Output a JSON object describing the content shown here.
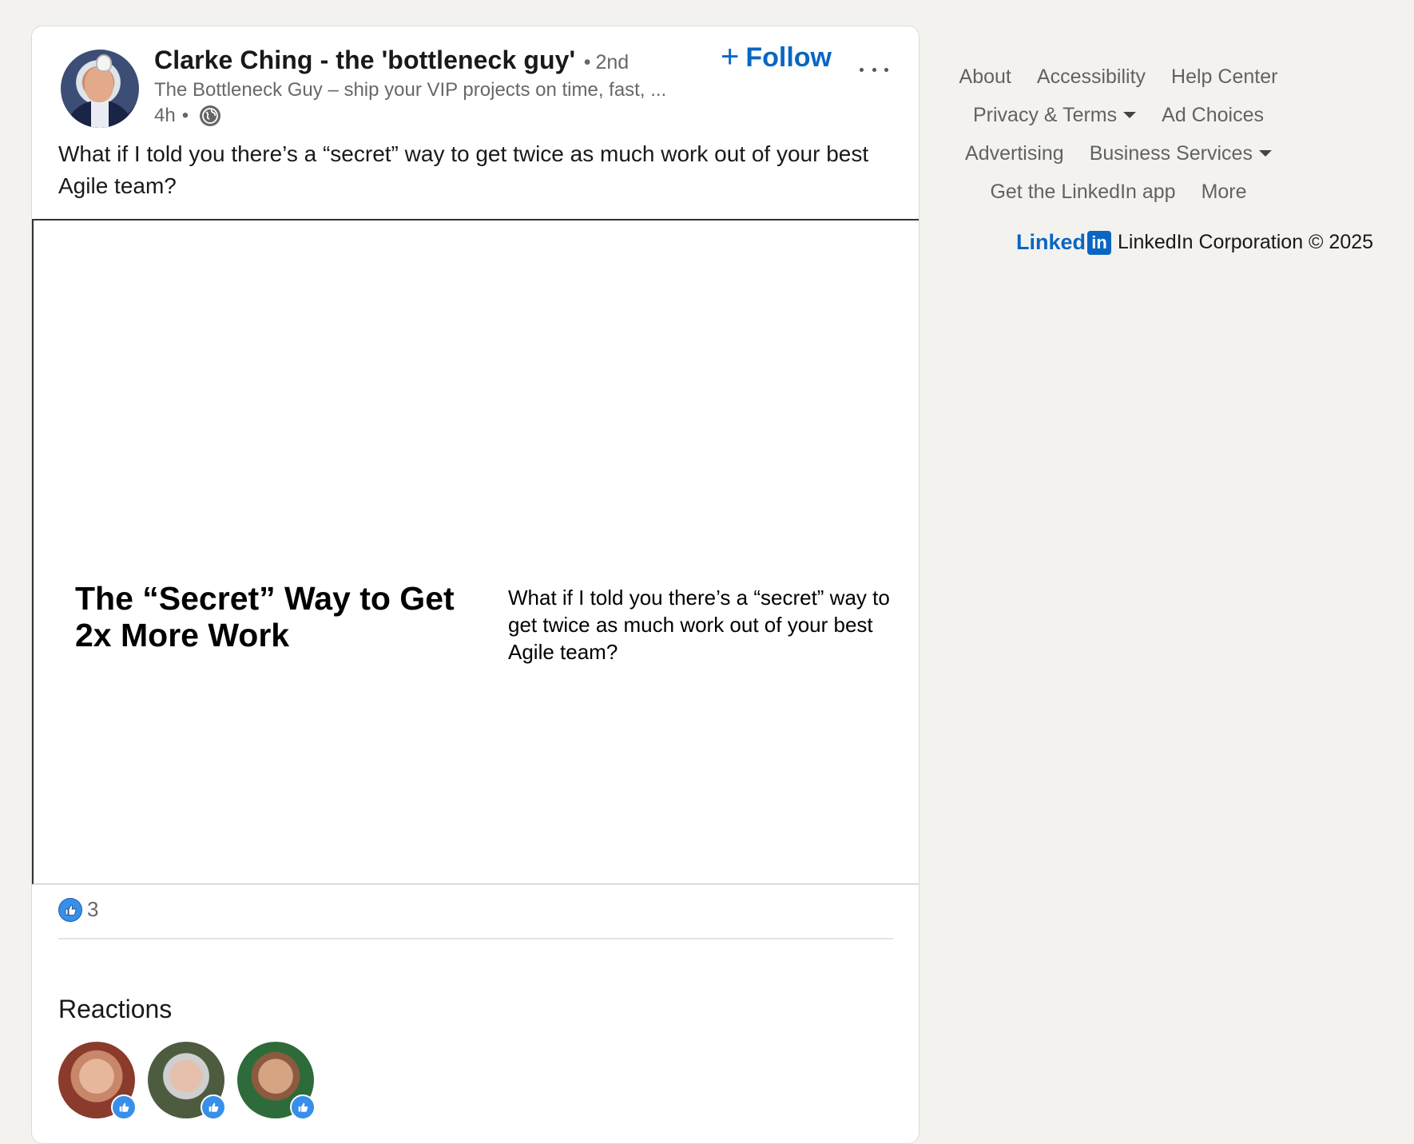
{
  "post": {
    "author": {
      "name": "Clarke Ching - the 'bottleneck guy'",
      "degree_dot": "•",
      "degree": "2nd",
      "headline": "The Bottleneck Guy – ship your VIP projects on time, fast, ...",
      "timestamp": "4h",
      "meta_dot": "•",
      "visibility_icon": "globe-icon"
    },
    "follow": {
      "plus": "+",
      "label": "Follow"
    },
    "text": "What if I told you there’s a “secret” way to get twice as much work out of your best Agile team?",
    "media": {
      "title": "The “Secret” Way to Get 2x More Work",
      "description": "What if I told you there’s a “secret” way to get twice as much work out of your best Agile team?"
    },
    "reactions": {
      "count": "3",
      "icon": "like-icon",
      "heading": "Reactions"
    }
  },
  "footer": {
    "rows": [
      [
        "About",
        "Accessibility",
        "Help Center"
      ],
      [
        "Privacy & Terms",
        "Ad Choices"
      ],
      [
        "Advertising",
        "Business Services"
      ],
      [
        "Get the LinkedIn app",
        "More"
      ]
    ],
    "logo_text": "Linked",
    "logo_in": "in",
    "copyright": "LinkedIn Corporation © 2025"
  },
  "colors": {
    "background": "#f3f2ef",
    "accent": "#0a66c2",
    "like": "#378fe9"
  }
}
